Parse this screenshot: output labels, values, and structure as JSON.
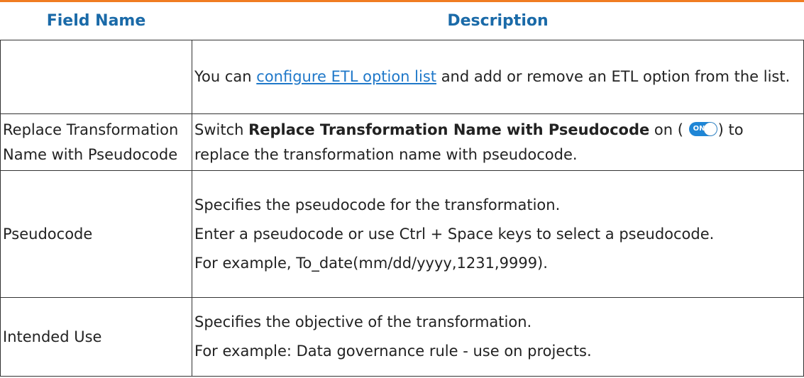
{
  "colors": {
    "top_rule": "#f07c22",
    "header_text": "#1a6aa8",
    "link": "#1f78c9",
    "toggle_on": "#1f86d6"
  },
  "header": {
    "field_name": "Field Name",
    "description": "Description"
  },
  "rows": [
    {
      "field": "",
      "desc": {
        "pre": "You can ",
        "link": "configure ETL option list",
        "post": " and add or remove an ETL option from the list."
      }
    },
    {
      "field": "Replace Transformation Name with Pseudocode",
      "desc": {
        "pre": "Switch ",
        "bold": "Replace Transformation Name with Pseudocode",
        "mid": " on (",
        "toggle_label": "ON",
        "post": ") to replace the transformation name with pseudocode."
      }
    },
    {
      "field": "Pseudocode",
      "paragraphs": [
        "Specifies the pseudocode for the transformation.",
        "Enter a pseudocode or use Ctrl + Space keys to select a pseudocode.",
        "For example, To_date(mm/dd/yyyy,1231,9999)."
      ]
    },
    {
      "field": "Intended Use",
      "paragraphs": [
        "Specifies the objective of the transformation.",
        "For example: Data governance rule - use on projects."
      ]
    }
  ],
  "icons": {
    "toggle": "toggle-switch-on-icon"
  }
}
